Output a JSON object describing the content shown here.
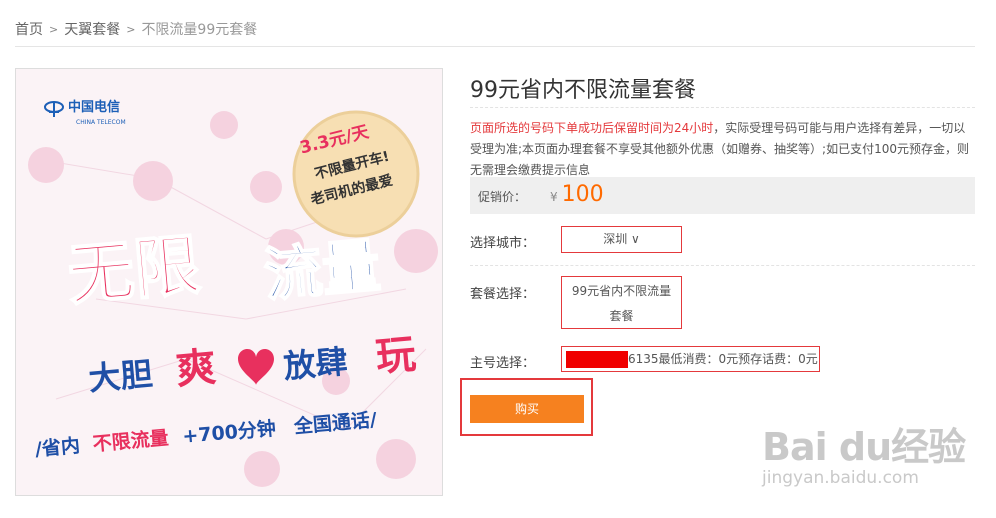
{
  "breadcrumb": {
    "items": [
      "首页",
      "天翼套餐",
      "不限流量99元套餐"
    ],
    "separator": ">"
  },
  "poster": {
    "brand_cn": "中国电信",
    "brand_en": "CHINA TELECOM",
    "badge_price": "3.3元/天",
    "badge_line1": "不限量开车!",
    "badge_line2": "老司机的最爱",
    "headline_part1": "无限",
    "headline_part2": "流量",
    "slogan_part1": "大胆",
    "slogan_part2": "爽",
    "slogan_part3": "放肆",
    "slogan_part4": "玩",
    "bottom_part1": "/省内",
    "bottom_part2": "不限流量",
    "bottom_part3": "+700分钟",
    "bottom_part4": "全国通话/",
    "colors": {
      "pink": "#e8305e",
      "blue": "#1f4fa6",
      "badge": "#f5ddb0"
    }
  },
  "product": {
    "title": "99元省内不限流量套餐",
    "notice_red": "页面所选的号码下单成功后保留时间为24小时",
    "notice_rest": "，实际受理号码可能与用户选择有差异，一切以受理为准;本页面办理套餐不享受其他额外优惠（如赠券、抽奖等）;如已支付100元预存金，则无需理会缴费提示信息",
    "price_label": "促销价：",
    "currency": "¥",
    "price": "100",
    "city_label": "选择城市：",
    "city_value": "深圳 ∨",
    "package_label": "套餐选择：",
    "package_value": "99元省内不限流量套餐",
    "number_label": "主号选择：",
    "number_text": "6135最低消费：0元预存话费：0元",
    "buy_label": "购买",
    "accent": "#e4393c",
    "button_color": "#f6811f"
  },
  "watermark": {
    "big": "Bai du经验",
    "small": "jingyan.baidu.com"
  }
}
